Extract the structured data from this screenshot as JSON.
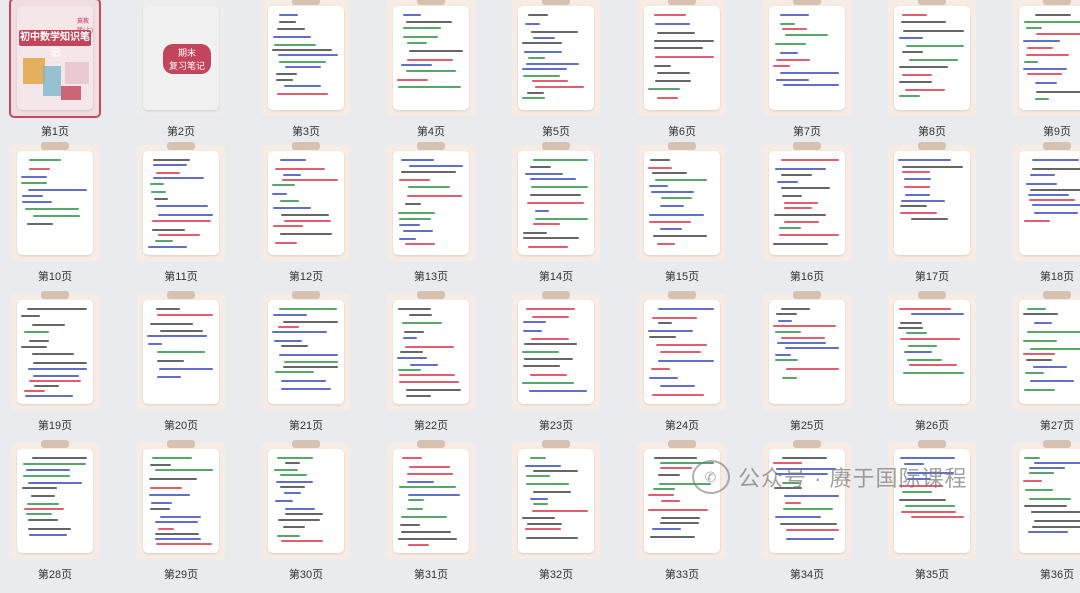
{
  "cover": {
    "tag": "冀教版(上)",
    "title": "初中数学知识笔记"
  },
  "review": {
    "line1": "期末",
    "line2": "复习笔记"
  },
  "pages": [
    "第1页",
    "第2页",
    "第3页",
    "第4页",
    "第5页",
    "第6页",
    "第7页",
    "第8页",
    "第9页",
    "第10页",
    "第11页",
    "第12页",
    "第13页",
    "第14页",
    "第15页",
    "第16页",
    "第17页",
    "第18页",
    "第19页",
    "第20页",
    "第21页",
    "第22页",
    "第23页",
    "第24页",
    "第25页",
    "第26页",
    "第27页",
    "第28页",
    "第29页",
    "第30页",
    "第31页",
    "第32页",
    "第33页",
    "第34页",
    "第35页",
    "第36页"
  ],
  "watermark": {
    "icon": "wechat-icon",
    "text": "公众号 · 赓于国际课程"
  },
  "colors": {
    "accent": "#c3455b",
    "blue_ink": "#2a3fb8",
    "green_ink": "#1f8a3a",
    "red_ink": "#d6283c",
    "black_ink": "#333333"
  }
}
